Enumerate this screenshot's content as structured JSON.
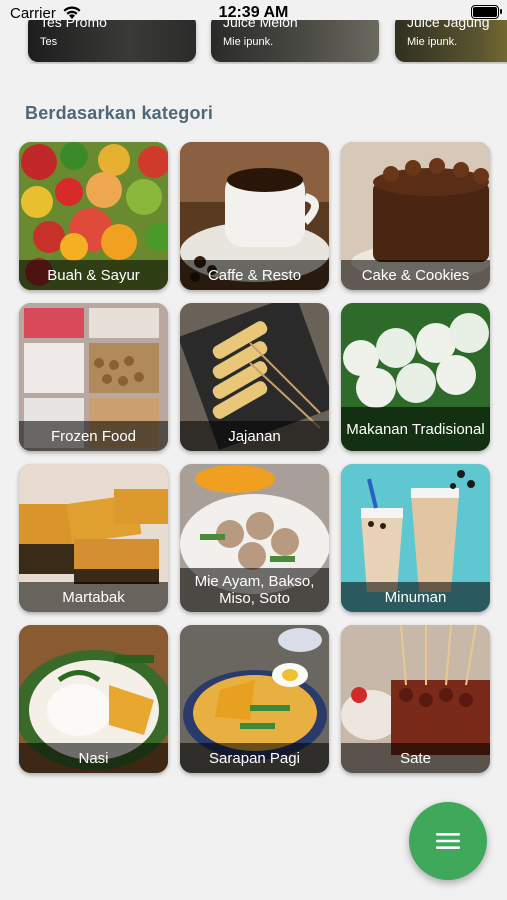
{
  "status_bar": {
    "carrier": "Carrier",
    "time": "12:39 AM"
  },
  "promos": [
    {
      "title": "Tes Promo",
      "subtitle": "Tes"
    },
    {
      "title": "Juice Melon",
      "subtitle": "Mie ipunk."
    },
    {
      "title": "Juice Jagung",
      "subtitle": "Mie ipunk."
    }
  ],
  "section_title": "Berdasarkan kategori",
  "categories": [
    {
      "label": "Buah & Sayur"
    },
    {
      "label": "Caffe & Resto"
    },
    {
      "label": "Cake & Cookies"
    },
    {
      "label": "Frozen Food"
    },
    {
      "label": "Jajanan"
    },
    {
      "label": "Makanan Tradisional"
    },
    {
      "label": "Martabak"
    },
    {
      "label": "Mie Ayam, Bakso, Miso, Soto"
    },
    {
      "label": "Minuman"
    },
    {
      "label": "Nasi"
    },
    {
      "label": "Sarapan Pagi"
    },
    {
      "label": "Sate"
    }
  ],
  "fab": {
    "icon": "menu-icon",
    "color": "#3fa85a"
  },
  "colors": {
    "section_title": "#4f6878",
    "background": "#f1f1f1"
  }
}
